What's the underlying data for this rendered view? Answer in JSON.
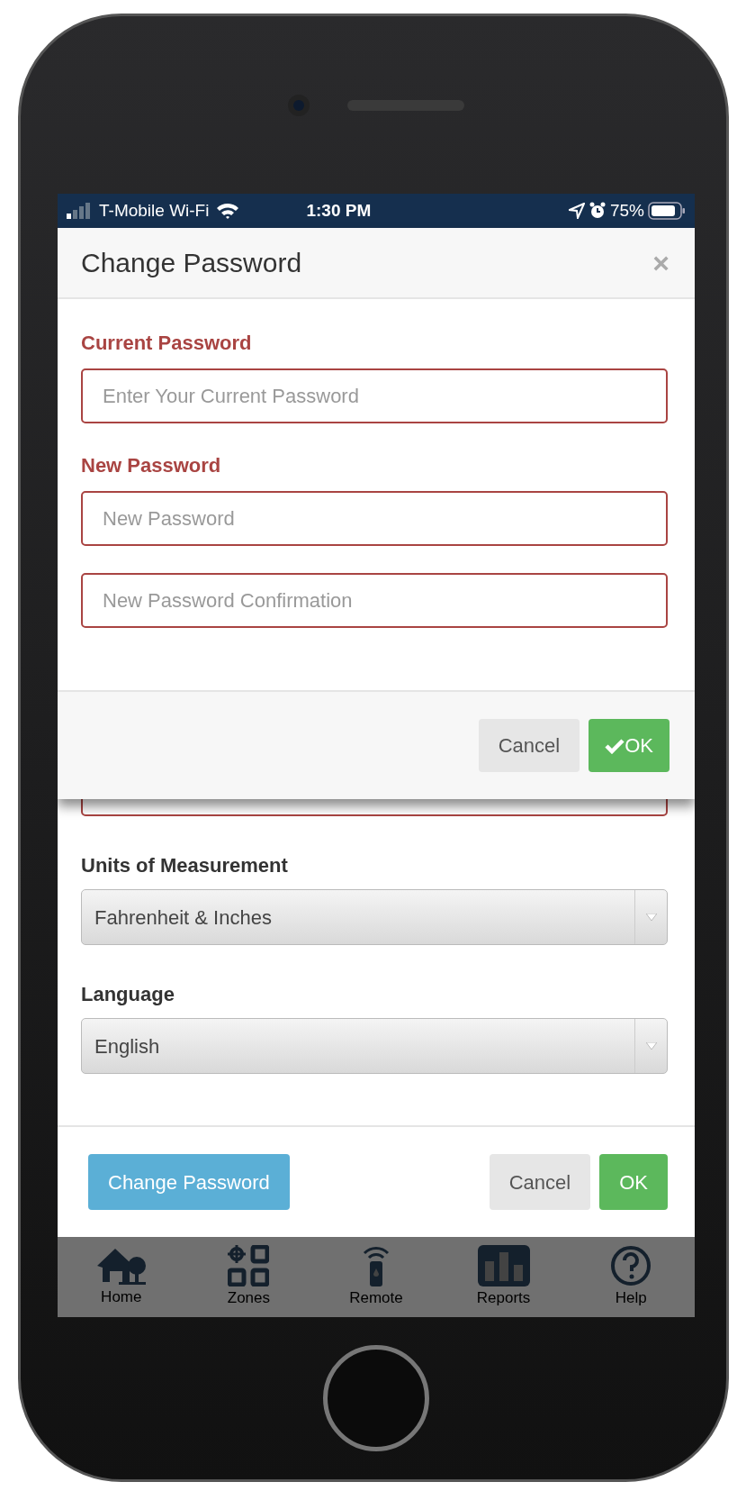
{
  "status_bar": {
    "carrier": "T-Mobile Wi-Fi",
    "time": "1:30 PM",
    "battery": "75%"
  },
  "modal": {
    "title": "Change Password",
    "close": "×",
    "fields": [
      {
        "label": "Current Password",
        "placeholder": "Enter Your Current Password"
      },
      {
        "label": "New Password",
        "placeholder": "New Password"
      },
      {
        "placeholder": "New Password Confirmation"
      }
    ],
    "buttons": [
      {
        "label": "Cancel",
        "kind": "default"
      },
      {
        "label": "OK",
        "kind": "ok"
      }
    ]
  },
  "page": {
    "selects": [
      {
        "label": "Units of Measurement",
        "value": "Fahrenheit & Inches"
      },
      {
        "label": "Language",
        "value": "English"
      }
    ],
    "footer_buttons": [
      {
        "label": "Change Password",
        "kind": "info"
      },
      {
        "label": "Cancel",
        "kind": "default"
      },
      {
        "label": "OK",
        "kind": "success"
      }
    ]
  },
  "tab_bar": [
    {
      "label": "Home"
    },
    {
      "label": "Zones"
    },
    {
      "label": "Remote"
    },
    {
      "label": "Reports"
    },
    {
      "label": "Help"
    }
  ]
}
